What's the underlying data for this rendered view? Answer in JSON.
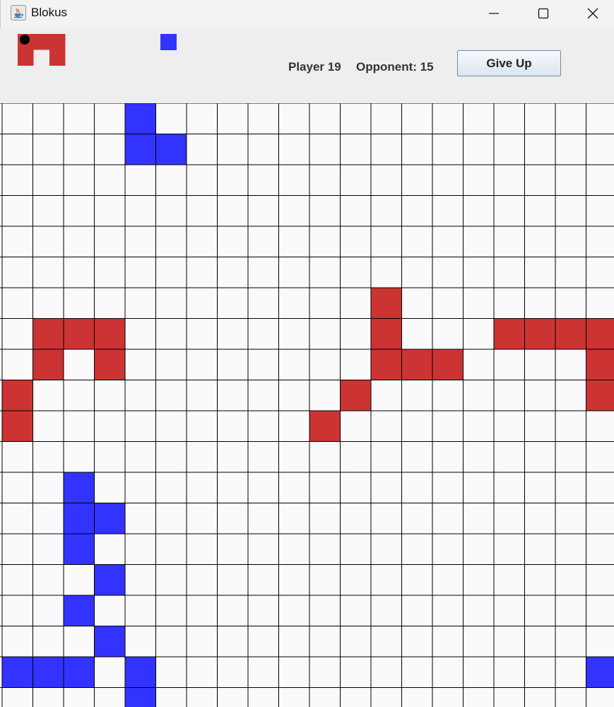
{
  "window": {
    "title": "Blokus",
    "icon": "java-coffee-cup-icon",
    "controls": [
      "minimize-icon",
      "maximize-icon",
      "close-icon"
    ]
  },
  "header": {
    "player_score_label": "Player 19",
    "opponent_score_label": "Opponent: 15",
    "give_up_label": "Give Up",
    "selected_piece": {
      "color": "#cc3333",
      "cells": [
        [
          0,
          0
        ],
        [
          1,
          0
        ],
        [
          2,
          0
        ],
        [
          0,
          1
        ],
        [
          2,
          1
        ]
      ],
      "has_pivot_marker": true
    },
    "opponent_preview_piece": {
      "color": "#3333ff",
      "cells": [
        [
          0,
          0
        ]
      ]
    }
  },
  "board": {
    "columns": 20,
    "rows": 20,
    "visible_columns": 20,
    "visible_rows": 20,
    "empty_color": "#fafafa",
    "grid_color": "#000000",
    "colors": {
      "R": "#cc3333",
      "B": "#3333ff"
    },
    "cells": [
      "....B...............",
      "....BB..............",
      "....................",
      "....................",
      "....................",
      "....................",
      "............R.......",
      ".RRR........R...RRRR",
      ".R.R........RRR....R",
      "R..........R.......R",
      "R.........R.........",
      "....................",
      "..B.................",
      "..BB................",
      "..B.................",
      "...B................",
      "..B.................",
      "...B................",
      "BBB.B..............B",
      "....B..............."
    ]
  }
}
